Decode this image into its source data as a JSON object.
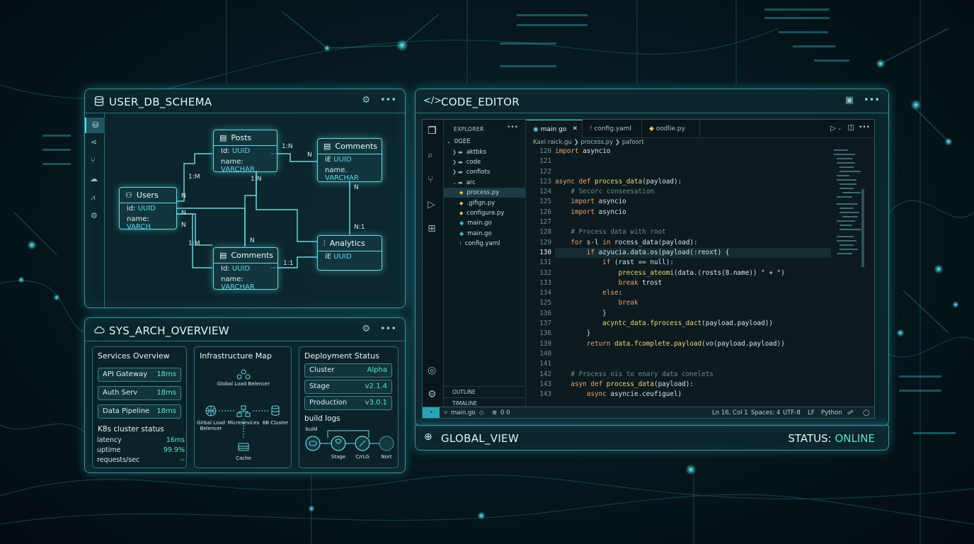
{
  "schema_panel": {
    "title": "USER_DB_SCHEMA",
    "tables": {
      "users": {
        "name": "Users",
        "rows": [
          {
            "k": "id:",
            "v": "UUID"
          },
          {
            "k": "name:",
            "v": "VARCH"
          }
        ]
      },
      "posts": {
        "name": "Posts",
        "rows": [
          {
            "k": "Id:",
            "v": "UUID"
          },
          {
            "k": "name:",
            "v": "VARCHAR"
          }
        ]
      },
      "comments_top": {
        "name": "Comments",
        "rows": [
          {
            "k": "iE",
            "v": "UUID"
          },
          {
            "k": "name.",
            "v": "VARCHAR"
          }
        ]
      },
      "comments_bottom": {
        "name": "Comments",
        "rows": [
          {
            "k": "Id:",
            "v": "UUID"
          },
          {
            "k": "name:",
            "v": "VARCHAR"
          }
        ]
      },
      "analytics": {
        "name": "Analytics",
        "rows": [
          {
            "k": "iE",
            "v": "UUID"
          }
        ]
      }
    },
    "relations": [
      "1:M",
      "1:M",
      "1:N",
      "1:N",
      "N",
      "N",
      "N",
      "N",
      "N:1",
      "N",
      "1:1",
      "N"
    ]
  },
  "arch_panel": {
    "title": "SYS_ARCH_OVERVIEW",
    "services": {
      "title": "Services Overview",
      "items": [
        {
          "label": "API Gateway",
          "value": "18ms"
        },
        {
          "label": "Auth Serv",
          "value": "18ms"
        },
        {
          "label": "Data Pipeline",
          "value": "18ms"
        }
      ],
      "k8s_title": "K8s cluster status",
      "k8s": [
        {
          "label": "latency",
          "value": "16ms"
        },
        {
          "label": "uptime",
          "value": "99.9%"
        },
        {
          "label": "requests/sec",
          "value": "--"
        }
      ]
    },
    "infra": {
      "title": "Infrastructure Map",
      "nodes": [
        "Global Load Belencer",
        "Glrbal Load Belencer",
        "Micresevices",
        "6B Cluster",
        "Cache"
      ]
    },
    "deploy": {
      "title": "Deployment Status",
      "items": [
        {
          "label": "Cluster",
          "value": "Alpha"
        },
        {
          "label": "Stage",
          "value": "v2.1.4"
        },
        {
          "label": "Production",
          "value": "v3.0.1"
        }
      ],
      "logs_title": "build logs",
      "steps": [
        "build",
        "Stage",
        "C/rLG",
        "Nort"
      ]
    }
  },
  "code_panel": {
    "title": "CODE_EDITOR",
    "explorer_title": "EXPLORER",
    "tree": [
      {
        "label": "0GEE",
        "icon": "chevron-down"
      },
      {
        "label": "aktbks",
        "icon": "folder"
      },
      {
        "label": "code",
        "icon": "folder"
      },
      {
        "label": "confiots",
        "icon": "folder"
      },
      {
        "label": "arc",
        "icon": "folder-open"
      },
      {
        "label": "process.py",
        "icon": "python"
      },
      {
        "label": ".gifign.py",
        "icon": "python"
      },
      {
        "label": "configure.py",
        "icon": "python"
      },
      {
        "label": "main.go",
        "icon": "go"
      },
      {
        "label": "main.go",
        "icon": "go"
      },
      {
        "label": "config.yaml",
        "icon": "yaml"
      }
    ],
    "outline": "OUTLINE",
    "timeline": "TIMALINE",
    "tabs": [
      "main go",
      "config.yaml",
      "oodlie.py"
    ],
    "breadcrumb": [
      "Kaxi raick.gu",
      "process.py",
      "pafoort"
    ],
    "lines": [
      {
        "n": "120",
        "t": "import asyncio"
      },
      {
        "n": "121",
        "t": ""
      },
      {
        "n": "122",
        "t": ""
      },
      {
        "n": "123",
        "t": "async def process_data(payload):"
      },
      {
        "n": "124",
        "t": "    # Secorc conseesation"
      },
      {
        "n": "125",
        "t": "    import asyncio"
      },
      {
        "n": "126",
        "t": "    import asyncio"
      },
      {
        "n": "127",
        "t": ""
      },
      {
        "n": "128",
        "t": "    # Process data with root"
      },
      {
        "n": "129",
        "t": "    for s-l in rocess_data(payload):"
      },
      {
        "n": "130",
        "t": "        if azyucia.data.os(payload(:reoxt) {"
      },
      {
        "n": "131",
        "t": "            if (rast == null):"
      },
      {
        "n": "132",
        "t": "                precess_ateomi(data.(rosts(8.name)) \" + \")"
      },
      {
        "n": "133",
        "t": "                break trost"
      },
      {
        "n": "134",
        "t": "            else:"
      },
      {
        "n": "125",
        "t": "                break"
      },
      {
        "n": "136",
        "t": "            }"
      },
      {
        "n": "137",
        "t": "            acyntc_data.fprocess_dact(payload.payload))"
      },
      {
        "n": "136",
        "t": "        }"
      },
      {
        "n": "139",
        "t": "        return data.fcomplete.payload(vo(payload.payload))"
      },
      {
        "n": "140",
        "t": ""
      },
      {
        "n": "141",
        "t": ""
      },
      {
        "n": "142",
        "t": "    # Process_ois to enary data conelets"
      },
      {
        "n": "143",
        "t": "    asyn def process_data(payload):"
      },
      {
        "n": "143",
        "t": "        async asyncie.ceufiguel)"
      }
    ],
    "status": {
      "branch": "main.go",
      "problems": "0 0",
      "position": "Ln 16, Col 1",
      "spaces": "Spaces: 4",
      "encoding": "UTF-8",
      "eol": "LF",
      "language": "Python"
    }
  },
  "global_panel": {
    "title": "GLOBAL_VIEW",
    "status_label": "STATUS:",
    "status_value": "ONLINE"
  },
  "colors": {
    "accent": "#5fd6e8",
    "ok": "#5ee5c8",
    "online": "#63e3bf"
  }
}
